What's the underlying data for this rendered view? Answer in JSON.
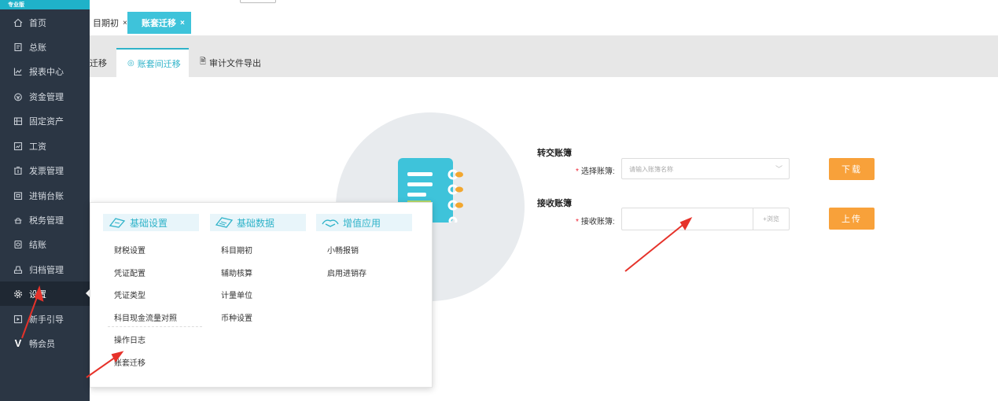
{
  "sidebar": {
    "badge": "专业版",
    "items": [
      {
        "label": "首页",
        "icon": "home-icon"
      },
      {
        "label": "总账",
        "icon": "ledger-icon"
      },
      {
        "label": "报表中心",
        "icon": "chart-icon"
      },
      {
        "label": "资金管理",
        "icon": "fund-icon"
      },
      {
        "label": "固定资产",
        "icon": "asset-icon"
      },
      {
        "label": "工资",
        "icon": "salary-icon"
      },
      {
        "label": "发票管理",
        "icon": "invoice-icon"
      },
      {
        "label": "进销台账",
        "icon": "inventory-icon"
      },
      {
        "label": "税务管理",
        "icon": "tax-icon"
      },
      {
        "label": "结账",
        "icon": "close-account-icon"
      },
      {
        "label": "归档管理",
        "icon": "archive-icon"
      },
      {
        "label": "设置",
        "icon": "gear-icon"
      },
      {
        "label": "新手引导",
        "icon": "guide-icon"
      },
      {
        "label": "畅会员",
        "icon": "vip-icon"
      }
    ]
  },
  "tabs": [
    {
      "label": "目期初",
      "close": "×"
    },
    {
      "label": "账套迁移",
      "close": "×"
    }
  ],
  "subtabs": [
    {
      "label": "迁移"
    },
    {
      "label": "账套间迁移",
      "icon": "◎"
    },
    {
      "label": "审计文件导出",
      "icon": "🗎"
    }
  ],
  "form": {
    "transfer_title": "转交账簿",
    "select_label": "选择账簿:",
    "select_placeholder": "请输入账簿名称",
    "download_button": "下载",
    "receive_title": "接收账簿",
    "receive_label": "接收账簿:",
    "browse_label": "+浏览",
    "upload_button": "上传",
    "required_mark": "*"
  },
  "popup": {
    "columns": [
      {
        "title": "基础设置",
        "items": [
          "财税设置",
          "凭证配置",
          "凭证类型",
          "科目现金流量对照",
          "操作日志",
          "账套迁移"
        ]
      },
      {
        "title": "基础数据",
        "items": [
          "科目期初",
          "辅助核算",
          "计量单位",
          "币种设置"
        ]
      },
      {
        "title": "增值应用",
        "items": [
          "小畅报销",
          "启用进销存"
        ]
      }
    ]
  },
  "colors": {
    "sidebar_bg": "#2b3644",
    "accent": "#3ec3da",
    "button_orange": "#f8a13a",
    "arrow_red": "#e6322a"
  }
}
